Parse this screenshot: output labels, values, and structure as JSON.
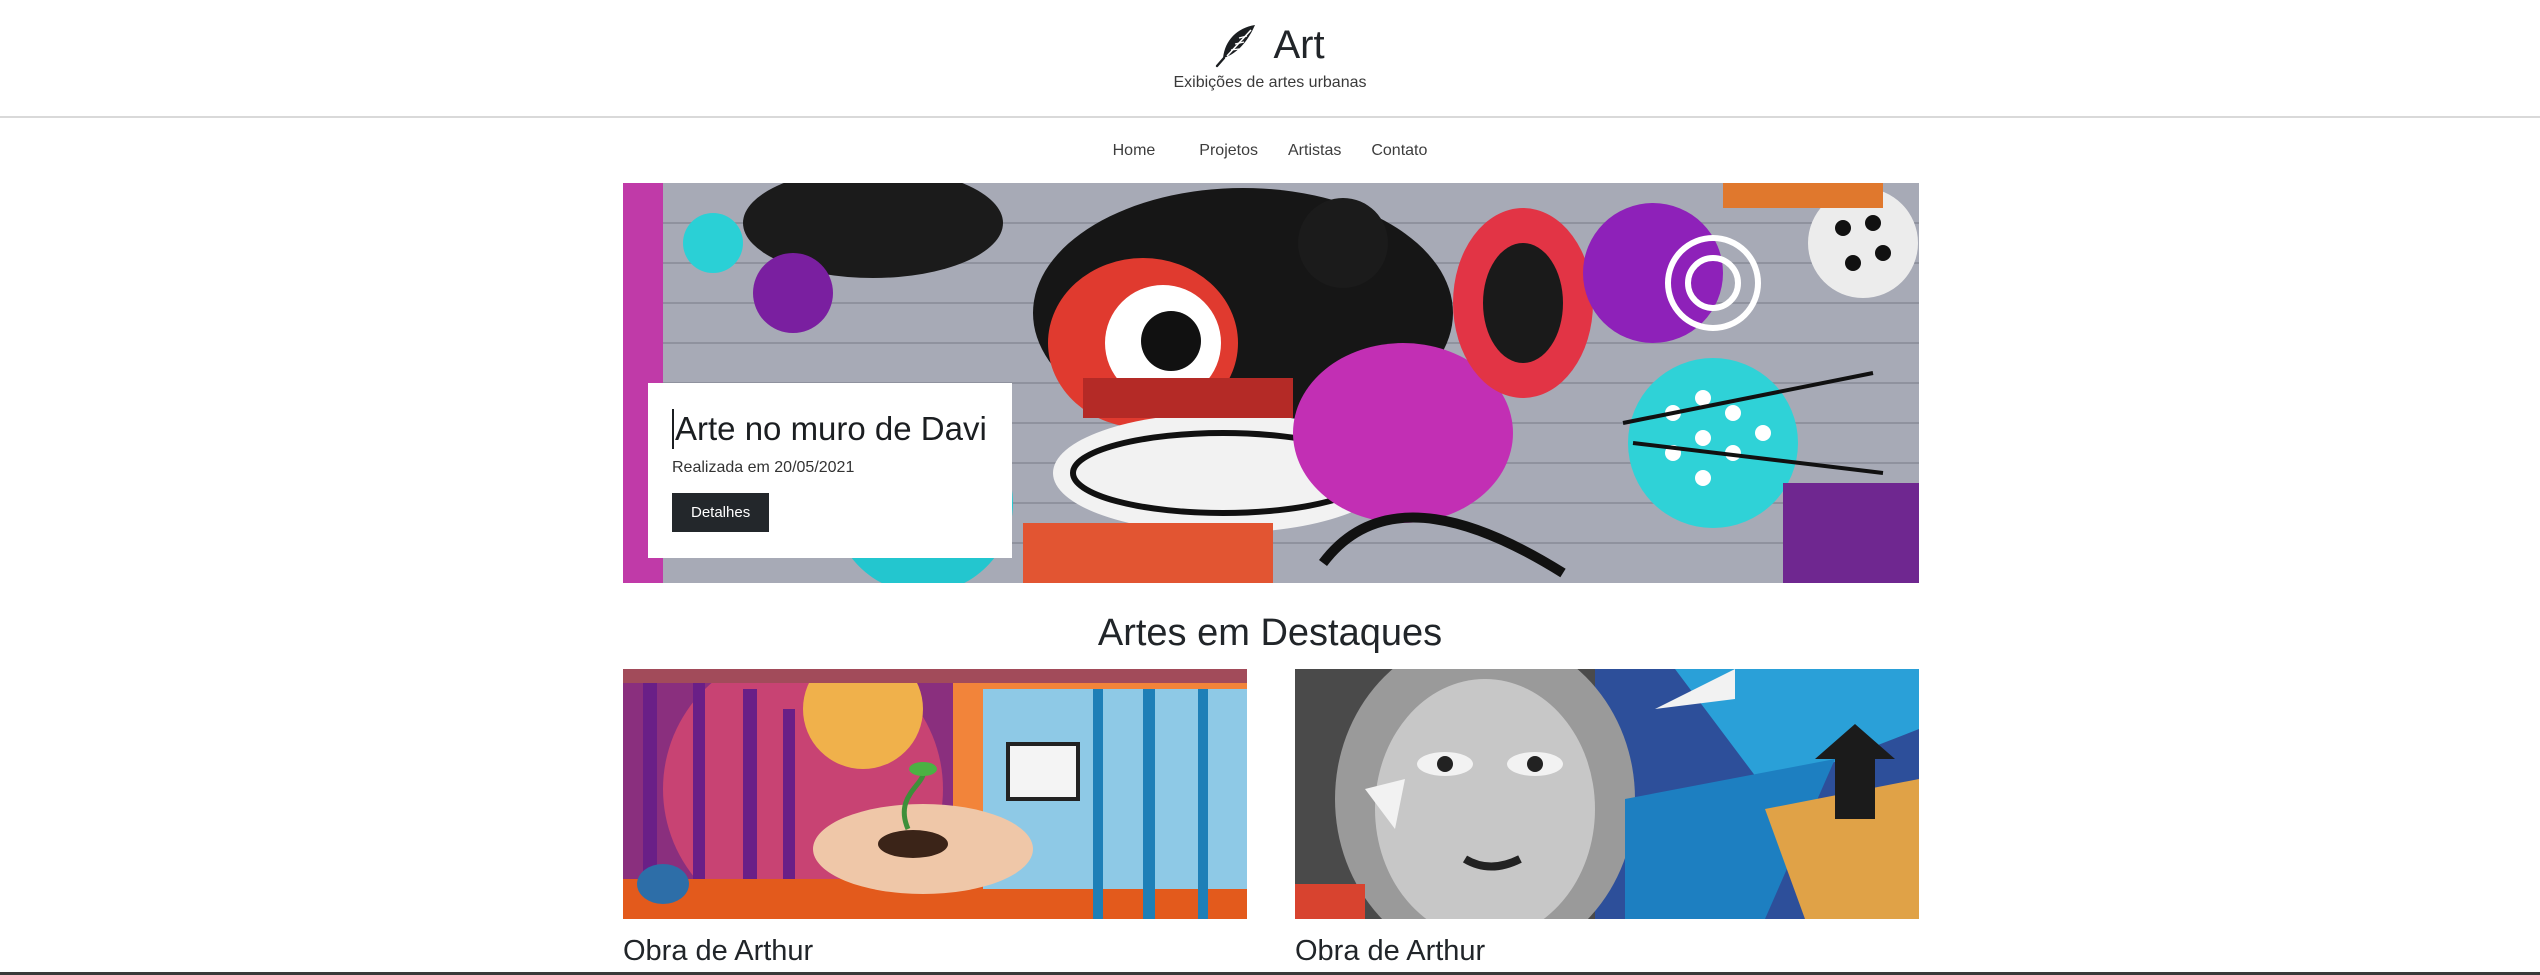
{
  "header": {
    "brand_icon": "feather-icon",
    "title": "Art",
    "tagline": "Exibições de artes urbanas"
  },
  "nav": {
    "items": [
      {
        "label": "Home"
      },
      {
        "label": "Projetos"
      },
      {
        "label": "Artistas"
      },
      {
        "label": "Contato"
      }
    ]
  },
  "hero": {
    "title": "Arte no muro de Davi",
    "date": "Realizada em 20/05/2021",
    "button_label": "Detalhes"
  },
  "featured": {
    "title": "Artes em Destaques",
    "cards": [
      {
        "title": "Obra de Arthur"
      },
      {
        "title": "Obra de Arthur"
      }
    ]
  },
  "colors": {
    "text": "#212529",
    "button_bg": "#23272b",
    "divider": "#d9d9d9"
  }
}
